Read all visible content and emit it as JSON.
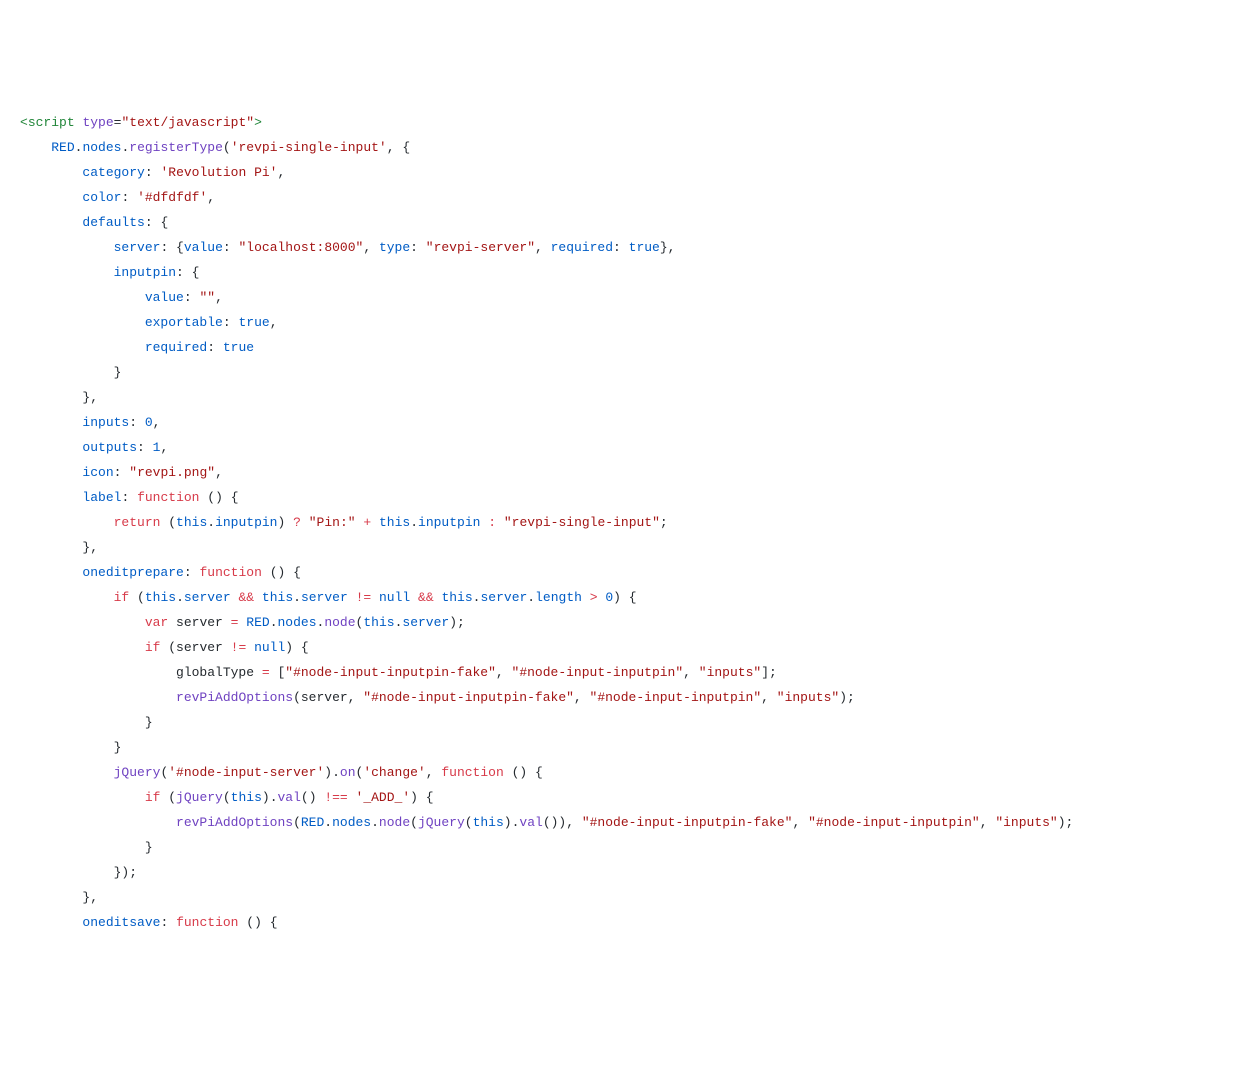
{
  "lines": [
    [
      [
        "<",
        "t-tag"
      ],
      [
        "script",
        "t-tag"
      ],
      [
        " ",
        "t-def"
      ],
      [
        "type",
        "t-attr"
      ],
      [
        "=",
        "t-def"
      ],
      [
        "\"text/javascript\"",
        "t-str"
      ],
      [
        ">",
        "t-tag"
      ]
    ],
    [
      [
        "    ",
        "t-def"
      ],
      [
        "RED",
        "t-obj"
      ],
      [
        ".",
        "t-def"
      ],
      [
        "nodes",
        "t-obj"
      ],
      [
        ".",
        "t-def"
      ],
      [
        "registerType",
        "t-fn"
      ],
      [
        "(",
        "t-def"
      ],
      [
        "'revpi-single-input'",
        "t-str"
      ],
      [
        ", {",
        "t-def"
      ]
    ],
    [
      [
        "        ",
        "t-def"
      ],
      [
        "category",
        "t-prop"
      ],
      [
        ":",
        "t-def"
      ],
      [
        " ",
        "t-def"
      ],
      [
        "'Revolution Pi'",
        "t-str"
      ],
      [
        ",",
        "t-def"
      ]
    ],
    [
      [
        "        ",
        "t-def"
      ],
      [
        "color",
        "t-prop"
      ],
      [
        ":",
        "t-def"
      ],
      [
        " ",
        "t-def"
      ],
      [
        "'#dfdfdf'",
        "t-str"
      ],
      [
        ",",
        "t-def"
      ]
    ],
    [
      [
        "        ",
        "t-def"
      ],
      [
        "defaults",
        "t-prop"
      ],
      [
        ":",
        "t-def"
      ],
      [
        " {",
        "t-def"
      ]
    ],
    [
      [
        "            ",
        "t-def"
      ],
      [
        "server",
        "t-prop"
      ],
      [
        ":",
        "t-def"
      ],
      [
        " {",
        "t-def"
      ],
      [
        "value",
        "t-prop"
      ],
      [
        ":",
        "t-def"
      ],
      [
        " ",
        "t-def"
      ],
      [
        "\"localhost:8000\"",
        "t-str"
      ],
      [
        ", ",
        "t-def"
      ],
      [
        "type",
        "t-prop"
      ],
      [
        ":",
        "t-def"
      ],
      [
        " ",
        "t-def"
      ],
      [
        "\"revpi-server\"",
        "t-str"
      ],
      [
        ", ",
        "t-def"
      ],
      [
        "required",
        "t-prop"
      ],
      [
        ":",
        "t-def"
      ],
      [
        " ",
        "t-def"
      ],
      [
        "true",
        "t-obj"
      ],
      [
        "},",
        "t-def"
      ]
    ],
    [
      [
        "            ",
        "t-def"
      ],
      [
        "inputpin",
        "t-prop"
      ],
      [
        ":",
        "t-def"
      ],
      [
        " {",
        "t-def"
      ]
    ],
    [
      [
        "                ",
        "t-def"
      ],
      [
        "value",
        "t-prop"
      ],
      [
        ":",
        "t-def"
      ],
      [
        " ",
        "t-def"
      ],
      [
        "\"\"",
        "t-str"
      ],
      [
        ",",
        "t-def"
      ]
    ],
    [
      [
        "                ",
        "t-def"
      ],
      [
        "exportable",
        "t-prop"
      ],
      [
        ":",
        "t-def"
      ],
      [
        " ",
        "t-def"
      ],
      [
        "true",
        "t-obj"
      ],
      [
        ",",
        "t-def"
      ]
    ],
    [
      [
        "                ",
        "t-def"
      ],
      [
        "required",
        "t-prop"
      ],
      [
        ":",
        "t-def"
      ],
      [
        " ",
        "t-def"
      ],
      [
        "true",
        "t-obj"
      ]
    ],
    [
      [
        "            }",
        "t-def"
      ]
    ],
    [
      [
        "        },",
        "t-def"
      ]
    ],
    [
      [
        "        ",
        "t-def"
      ],
      [
        "inputs",
        "t-prop"
      ],
      [
        ":",
        "t-def"
      ],
      [
        " ",
        "t-def"
      ],
      [
        "0",
        "t-obj"
      ],
      [
        ",",
        "t-def"
      ]
    ],
    [
      [
        "        ",
        "t-def"
      ],
      [
        "outputs",
        "t-prop"
      ],
      [
        ":",
        "t-def"
      ],
      [
        " ",
        "t-def"
      ],
      [
        "1",
        "t-obj"
      ],
      [
        ",",
        "t-def"
      ]
    ],
    [
      [
        "        ",
        "t-def"
      ],
      [
        "icon",
        "t-prop"
      ],
      [
        ":",
        "t-def"
      ],
      [
        " ",
        "t-def"
      ],
      [
        "\"revpi.png\"",
        "t-str"
      ],
      [
        ",",
        "t-def"
      ]
    ],
    [
      [
        "        ",
        "t-def"
      ],
      [
        "label",
        "t-prop"
      ],
      [
        ":",
        "t-def"
      ],
      [
        " ",
        "t-def"
      ],
      [
        "function",
        "t-kw"
      ],
      [
        " () {",
        "t-def"
      ]
    ],
    [
      [
        "            ",
        "t-def"
      ],
      [
        "return",
        "t-kw"
      ],
      [
        " (",
        "t-def"
      ],
      [
        "this",
        "t-obj"
      ],
      [
        ".",
        "t-def"
      ],
      [
        "inputpin",
        "t-obj"
      ],
      [
        ") ",
        "t-def"
      ],
      [
        "?",
        "t-op"
      ],
      [
        " ",
        "t-def"
      ],
      [
        "\"Pin:\"",
        "t-str"
      ],
      [
        " ",
        "t-def"
      ],
      [
        "+",
        "t-op"
      ],
      [
        " ",
        "t-def"
      ],
      [
        "this",
        "t-obj"
      ],
      [
        ".",
        "t-def"
      ],
      [
        "inputpin",
        "t-obj"
      ],
      [
        " ",
        "t-def"
      ],
      [
        ":",
        "t-op"
      ],
      [
        " ",
        "t-def"
      ],
      [
        "\"revpi-single-input\"",
        "t-str"
      ],
      [
        ";",
        "t-def"
      ]
    ],
    [
      [
        "        },",
        "t-def"
      ]
    ],
    [
      [
        "        ",
        "t-def"
      ],
      [
        "oneditprepare",
        "t-prop"
      ],
      [
        ":",
        "t-def"
      ],
      [
        " ",
        "t-def"
      ],
      [
        "function",
        "t-kw"
      ],
      [
        " () {",
        "t-def"
      ]
    ],
    [
      [
        "            ",
        "t-def"
      ],
      [
        "if",
        "t-kw"
      ],
      [
        " (",
        "t-def"
      ],
      [
        "this",
        "t-obj"
      ],
      [
        ".",
        "t-def"
      ],
      [
        "server",
        "t-obj"
      ],
      [
        " ",
        "t-def"
      ],
      [
        "&&",
        "t-op"
      ],
      [
        " ",
        "t-def"
      ],
      [
        "this",
        "t-obj"
      ],
      [
        ".",
        "t-def"
      ],
      [
        "server",
        "t-obj"
      ],
      [
        " ",
        "t-def"
      ],
      [
        "!=",
        "t-op"
      ],
      [
        " ",
        "t-def"
      ],
      [
        "null",
        "t-obj"
      ],
      [
        " ",
        "t-def"
      ],
      [
        "&&",
        "t-op"
      ],
      [
        " ",
        "t-def"
      ],
      [
        "this",
        "t-obj"
      ],
      [
        ".",
        "t-def"
      ],
      [
        "server",
        "t-obj"
      ],
      [
        ".",
        "t-def"
      ],
      [
        "length",
        "t-obj"
      ],
      [
        " ",
        "t-def"
      ],
      [
        ">",
        "t-op"
      ],
      [
        " ",
        "t-def"
      ],
      [
        "0",
        "t-obj"
      ],
      [
        ") {",
        "t-def"
      ]
    ],
    [
      [
        "                ",
        "t-def"
      ],
      [
        "var",
        "t-kw"
      ],
      [
        " server ",
        "t-def"
      ],
      [
        "=",
        "t-op"
      ],
      [
        " ",
        "t-def"
      ],
      [
        "RED",
        "t-obj"
      ],
      [
        ".",
        "t-def"
      ],
      [
        "nodes",
        "t-obj"
      ],
      [
        ".",
        "t-def"
      ],
      [
        "node",
        "t-fn"
      ],
      [
        "(",
        "t-def"
      ],
      [
        "this",
        "t-obj"
      ],
      [
        ".",
        "t-def"
      ],
      [
        "server",
        "t-obj"
      ],
      [
        ");",
        "t-def"
      ]
    ],
    [
      [
        "                ",
        "t-def"
      ],
      [
        "if",
        "t-kw"
      ],
      [
        " (server ",
        "t-def"
      ],
      [
        "!=",
        "t-op"
      ],
      [
        " ",
        "t-def"
      ],
      [
        "null",
        "t-obj"
      ],
      [
        ") {",
        "t-def"
      ]
    ],
    [
      [
        "                    globalType ",
        "t-def"
      ],
      [
        "=",
        "t-op"
      ],
      [
        " [",
        "t-def"
      ],
      [
        "\"#node-input-inputpin-fake\"",
        "t-str"
      ],
      [
        ", ",
        "t-def"
      ],
      [
        "\"#node-input-inputpin\"",
        "t-str"
      ],
      [
        ", ",
        "t-def"
      ],
      [
        "\"inputs\"",
        "t-str"
      ],
      [
        "];",
        "t-def"
      ]
    ],
    [
      [
        "                    ",
        "t-def"
      ],
      [
        "revPiAddOptions",
        "t-fn"
      ],
      [
        "(server, ",
        "t-def"
      ],
      [
        "\"#node-input-inputpin-fake\"",
        "t-str"
      ],
      [
        ", ",
        "t-def"
      ],
      [
        "\"#node-input-inputpin\"",
        "t-str"
      ],
      [
        ", ",
        "t-def"
      ],
      [
        "\"inputs\"",
        "t-str"
      ],
      [
        ");",
        "t-def"
      ]
    ],
    [
      [
        "                }",
        "t-def"
      ]
    ],
    [
      [
        "            }",
        "t-def"
      ]
    ],
    [
      [
        "            ",
        "t-def"
      ],
      [
        "jQuery",
        "t-fn"
      ],
      [
        "(",
        "t-def"
      ],
      [
        "'#node-input-server'",
        "t-str"
      ],
      [
        ").",
        "t-def"
      ],
      [
        "on",
        "t-fn"
      ],
      [
        "(",
        "t-def"
      ],
      [
        "'change'",
        "t-str"
      ],
      [
        ", ",
        "t-def"
      ],
      [
        "function",
        "t-kw"
      ],
      [
        " () {",
        "t-def"
      ]
    ],
    [
      [
        "                ",
        "t-def"
      ],
      [
        "if",
        "t-kw"
      ],
      [
        " (",
        "t-def"
      ],
      [
        "jQuery",
        "t-fn"
      ],
      [
        "(",
        "t-def"
      ],
      [
        "this",
        "t-obj"
      ],
      [
        ").",
        "t-def"
      ],
      [
        "val",
        "t-fn"
      ],
      [
        "() ",
        "t-def"
      ],
      [
        "!==",
        "t-op"
      ],
      [
        " ",
        "t-def"
      ],
      [
        "'_ADD_'",
        "t-str"
      ],
      [
        ") {",
        "t-def"
      ]
    ],
    [
      [
        "                    ",
        "t-def"
      ],
      [
        "revPiAddOptions",
        "t-fn"
      ],
      [
        "(",
        "t-def"
      ],
      [
        "RED",
        "t-obj"
      ],
      [
        ".",
        "t-def"
      ],
      [
        "nodes",
        "t-obj"
      ],
      [
        ".",
        "t-def"
      ],
      [
        "node",
        "t-fn"
      ],
      [
        "(",
        "t-def"
      ],
      [
        "jQuery",
        "t-fn"
      ],
      [
        "(",
        "t-def"
      ],
      [
        "this",
        "t-obj"
      ],
      [
        ").",
        "t-def"
      ],
      [
        "val",
        "t-fn"
      ],
      [
        "()), ",
        "t-def"
      ],
      [
        "\"#node-input-inputpin-fake\"",
        "t-str"
      ],
      [
        ", ",
        "t-def"
      ],
      [
        "\"#node-input-inputpin\"",
        "t-str"
      ],
      [
        ", ",
        "t-def"
      ],
      [
        "\"inputs\"",
        "t-str"
      ],
      [
        ");",
        "t-def"
      ]
    ],
    [
      [
        "                }",
        "t-def"
      ]
    ],
    [
      [
        "            });",
        "t-def"
      ]
    ],
    [
      [
        "        },",
        "t-def"
      ]
    ],
    [
      [
        "        ",
        "t-def"
      ],
      [
        "oneditsave",
        "t-prop"
      ],
      [
        ":",
        "t-def"
      ],
      [
        " ",
        "t-def"
      ],
      [
        "function",
        "t-kw"
      ],
      [
        " () {",
        "t-def"
      ]
    ]
  ]
}
